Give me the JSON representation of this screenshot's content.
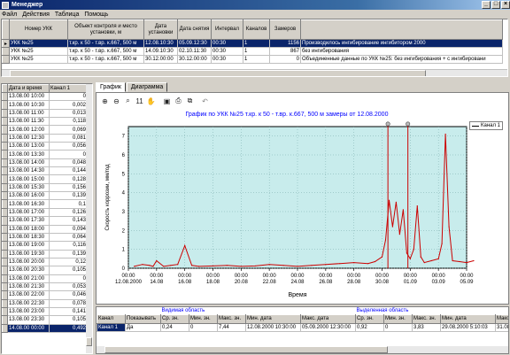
{
  "window": {
    "title": "Менеджер"
  },
  "menu": [
    "Файл",
    "Действия",
    "Таблица",
    "Помощь"
  ],
  "top_grid": {
    "columns": [
      "Номер УКК",
      "Объект контроля и место установки, м",
      "Дата установки",
      "Дата снятия",
      "Интервал",
      "Каналов",
      "Замеров",
      ""
    ],
    "rows": [
      {
        "selected": true,
        "cells": [
          "УКК №25",
          "т.кр. к 50 - т.вр. к.667, 500 м",
          "12.08.10:30",
          "05.09.12:30",
          "00:30",
          "1",
          "1156",
          "Производилось ингибирование ингибитором 2000"
        ]
      },
      {
        "selected": false,
        "cells": [
          "УКК №25",
          "т.кр. к 50 - т.вр. к.667, 500 м",
          "14.09.10:30",
          "02.10.11:30",
          "00:30",
          "1",
          "867",
          "без ингибирования"
        ]
      },
      {
        "selected": false,
        "cells": [
          "УКК №25",
          "т.кр. к 50 - т.вр. к.667, 500 м",
          "30.12.00:00",
          "30.12.00:00",
          "00:30",
          "1",
          "0",
          "Объединенные данные по УКК №25: без ингибирования + с ингибировани"
        ]
      }
    ]
  },
  "left_grid": {
    "columns": [
      "Дата и время",
      "Канал 1"
    ],
    "rows": [
      [
        "13.08.00 10:00",
        "0"
      ],
      [
        "13.08.00 10:30",
        "0,002"
      ],
      [
        "13.08.00 11:00",
        "0,013"
      ],
      [
        "13.08.00 11:30",
        "0,118"
      ],
      [
        "13.08.00 12:00",
        "0,069"
      ],
      [
        "13.08.00 12:30",
        "0,081"
      ],
      [
        "13.08.00 13:00",
        "0,056"
      ],
      [
        "13.08.00 13:30",
        "0"
      ],
      [
        "13.08.00 14:00",
        "0,048"
      ],
      [
        "13.08.00 14:30",
        "0,144"
      ],
      [
        "13.08.00 15:00",
        "0,128"
      ],
      [
        "13.08.00 15:30",
        "0,156"
      ],
      [
        "13.08.00 16:00",
        "0,139"
      ],
      [
        "13.08.00 16:30",
        "0,1"
      ],
      [
        "13.08.00 17:00",
        "0,126"
      ],
      [
        "13.08.00 17:30",
        "0,143"
      ],
      [
        "13.08.00 18:00",
        "0,094"
      ],
      [
        "13.08.00 18:30",
        "0,064"
      ],
      [
        "13.08.00 19:00",
        "0,116"
      ],
      [
        "13.08.00 19:30",
        "0,139"
      ],
      [
        "13.08.00 20:00",
        "0,12"
      ],
      [
        "13.08.00 20:30",
        "0,105"
      ],
      [
        "13.08.00 21:00",
        "0"
      ],
      [
        "13.08.00 21:30",
        "0,053"
      ],
      [
        "13.08.00 22:00",
        "0,046"
      ],
      [
        "13.08.00 22:30",
        "0,078"
      ],
      [
        "13.08.00 23:00",
        "0,141"
      ],
      [
        "13.08.00 23:30",
        "0,105"
      ],
      [
        "14.08.00 00:00",
        "0,492"
      ]
    ]
  },
  "tabs": [
    "График",
    "Диаграмма"
  ],
  "chart": {
    "title": "График по УКК №25 т.кр. к 50 - т.вр. к.667, 500 м замеры от 12.08.2000",
    "legend": "Канал 1",
    "line_color": "#cc0000",
    "plot_bg": "#c8ecec"
  },
  "chart_data": {
    "type": "line",
    "title": "График по УКК №25 т.кр. к 50 - т.вр. к.667, 500 м замеры от 12.08.2000",
    "xlabel": "Время",
    "ylabel": "Скорость коррозии, мм/год",
    "ylim": [
      0,
      7.5
    ],
    "yticks": [
      0,
      1,
      2,
      3,
      4,
      5,
      6,
      7
    ],
    "xlim": [
      "12.08 00:00",
      "05.09 00:00"
    ],
    "x_tick_labels": [
      [
        "00:00",
        "12.08.2000"
      ],
      [
        "00:00",
        "14.08"
      ],
      [
        "00:00",
        "16.08"
      ],
      [
        "00:00",
        "18.08"
      ],
      [
        "00:00",
        "20.08"
      ],
      [
        "00:00",
        "22.08"
      ],
      [
        "00:00",
        "24.08"
      ],
      [
        "00:00",
        "26.08"
      ],
      [
        "00:00",
        "28.08"
      ],
      [
        "00:00",
        "30.08"
      ],
      [
        "00:00",
        "01.09"
      ],
      [
        "00:00",
        "03.09"
      ],
      [
        "00:00",
        "05.09"
      ]
    ],
    "series": [
      {
        "name": "Канал 1",
        "x": [
          "12.08 10:00",
          "13.08 00:00",
          "13.08 12:00",
          "13.08 18:00",
          "14.08 00:00",
          "14.08 12:00",
          "15.08 00:00",
          "15.08 12:00",
          "16.08 00:00",
          "16.08 12:00",
          "17.08 00:00",
          "18.08 00:00",
          "19.08 00:00",
          "20.08 00:00",
          "21.08 00:00",
          "22.08 00:00",
          "23.08 00:00",
          "24.08 00:00",
          "25.08 00:00",
          "26.08 00:00",
          "27.08 00:00",
          "28.08 00:00",
          "29.08 00:00",
          "29.08 12:00",
          "30.08 00:00",
          "30.08 06:00",
          "30.08 12:00",
          "30.08 18:00",
          "31.08 00:00",
          "31.08 06:00",
          "31.08 12:00",
          "31.08 18:00",
          "01.09 00:00",
          "01.09 06:00",
          "01.09 12:00",
          "01.09 18:00",
          "02.09 00:00",
          "02.09 12:00",
          "03.09 00:00",
          "03.09 06:00",
          "03.09 12:00",
          "03.09 18:00",
          "04.09 00:00",
          "04.09 12:00",
          "05.09 00:00",
          "05.09 12:00"
        ],
        "values": [
          0.1,
          0.2,
          0.15,
          0.1,
          0.4,
          0.1,
          0.15,
          0.2,
          1.2,
          0.15,
          0.1,
          0.12,
          0.15,
          0.1,
          0.12,
          0.2,
          0.15,
          0.1,
          0.15,
          0.2,
          0.25,
          0.3,
          0.25,
          0.35,
          0.6,
          1.5,
          3.6,
          2.2,
          3.5,
          1.8,
          3.1,
          0.8,
          0.5,
          1.0,
          3.3,
          0.6,
          0.3,
          0.4,
          0.5,
          1.3,
          7.1,
          2.2,
          0.4,
          0.35,
          0.3,
          0.4
        ]
      }
    ],
    "markers": [
      "30.08 10:00",
      "31.08 20:00"
    ],
    "grid": true,
    "legend_position": "top-right"
  },
  "stats": {
    "groups": [
      "Видимая область",
      "Выделенная область"
    ],
    "columns": [
      "Канал",
      "Показывать",
      "Ср. зн.",
      "Мин. зн.",
      "Макс. зн.",
      "Мин. дата",
      "Макс. дата",
      "Ср. зн.",
      "Мин. зн.",
      "Макс. зн.",
      "Мин. дата",
      "Макс. дата"
    ],
    "row": [
      "Канал 1",
      "Да",
      "0,24",
      "0",
      "7,44",
      "12.08.2000 10:30:00",
      "05.09.2000 12:30:00",
      "0,92",
      "0",
      "3,83",
      "29.08.2000 5:10:03",
      "31.08.2000"
    ]
  }
}
